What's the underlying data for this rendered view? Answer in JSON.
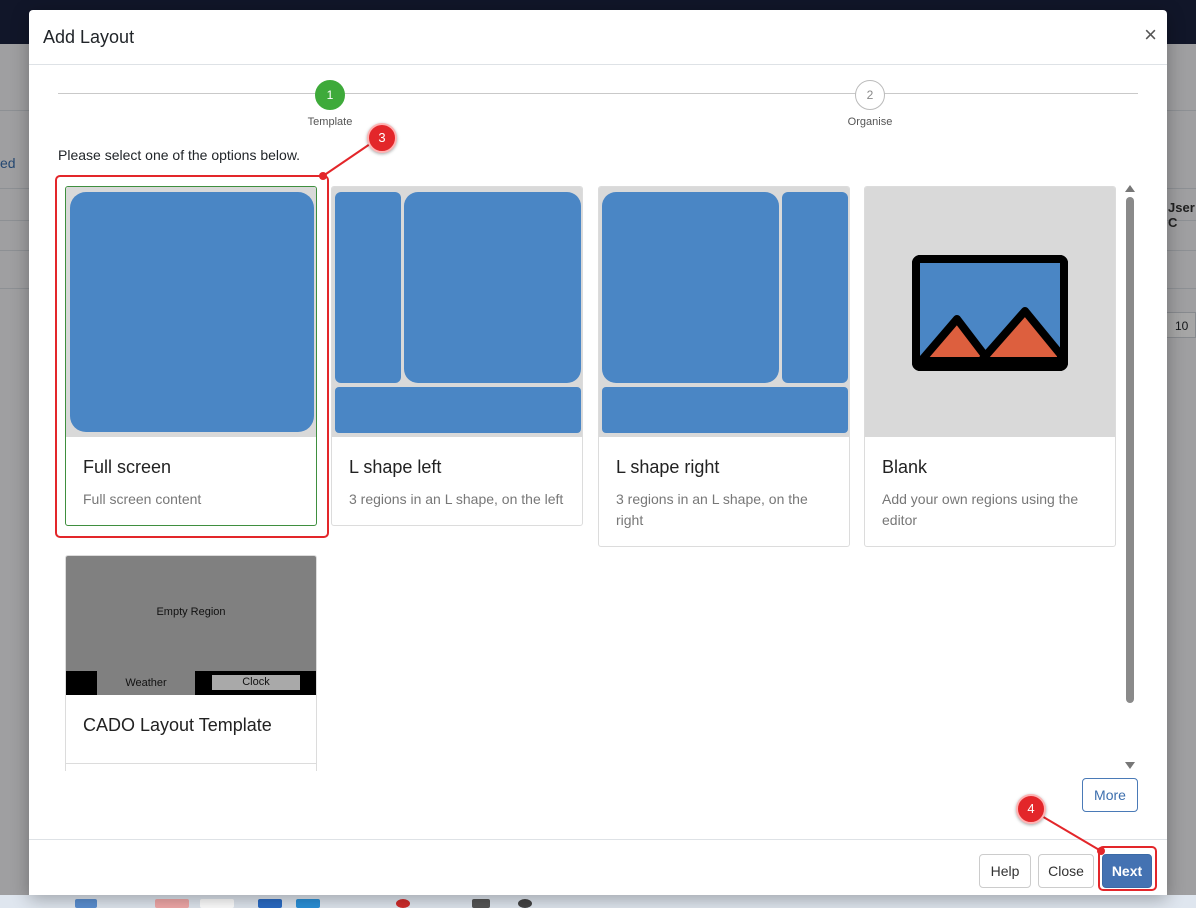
{
  "background": {
    "partial_link": "ed",
    "partial_column": "Jser C",
    "partial_value": "10"
  },
  "modal": {
    "title": "Add Layout",
    "close_symbol": "×"
  },
  "stepper": {
    "steps": [
      {
        "number": "1",
        "label": "Template",
        "state": "active"
      },
      {
        "number": "2",
        "label": "Organise",
        "state": "inactive"
      }
    ]
  },
  "instruction": "Please select one of the options below.",
  "templates": [
    {
      "title": "Full screen",
      "description": "Full screen content",
      "selected": true
    },
    {
      "title": "L shape left",
      "description": "3 regions in an L shape, on the left",
      "selected": false
    },
    {
      "title": "L shape right",
      "description": "3 regions in an L shape, on the right",
      "selected": false
    },
    {
      "title": "Blank",
      "description": "Add your own regions using the editor",
      "selected": false
    },
    {
      "title": "CADO Layout Template",
      "description": "",
      "selected": false,
      "preview": {
        "main_region": "Empty Region",
        "left_region": "Weather",
        "right_region": "Clock"
      }
    }
  ],
  "buttons": {
    "more": "More",
    "help": "Help",
    "close": "Close",
    "next": "Next"
  },
  "annotations": {
    "step_3": "3",
    "step_4": "4"
  },
  "colors": {
    "region_blue": "#4a86c5",
    "active_step_green": "#3eaa3a",
    "primary_button": "#4472b2",
    "annotation_red": "#e3262a",
    "blank_image_fill": "#4a86c5",
    "blank_mountain": "#dd5f3e"
  }
}
